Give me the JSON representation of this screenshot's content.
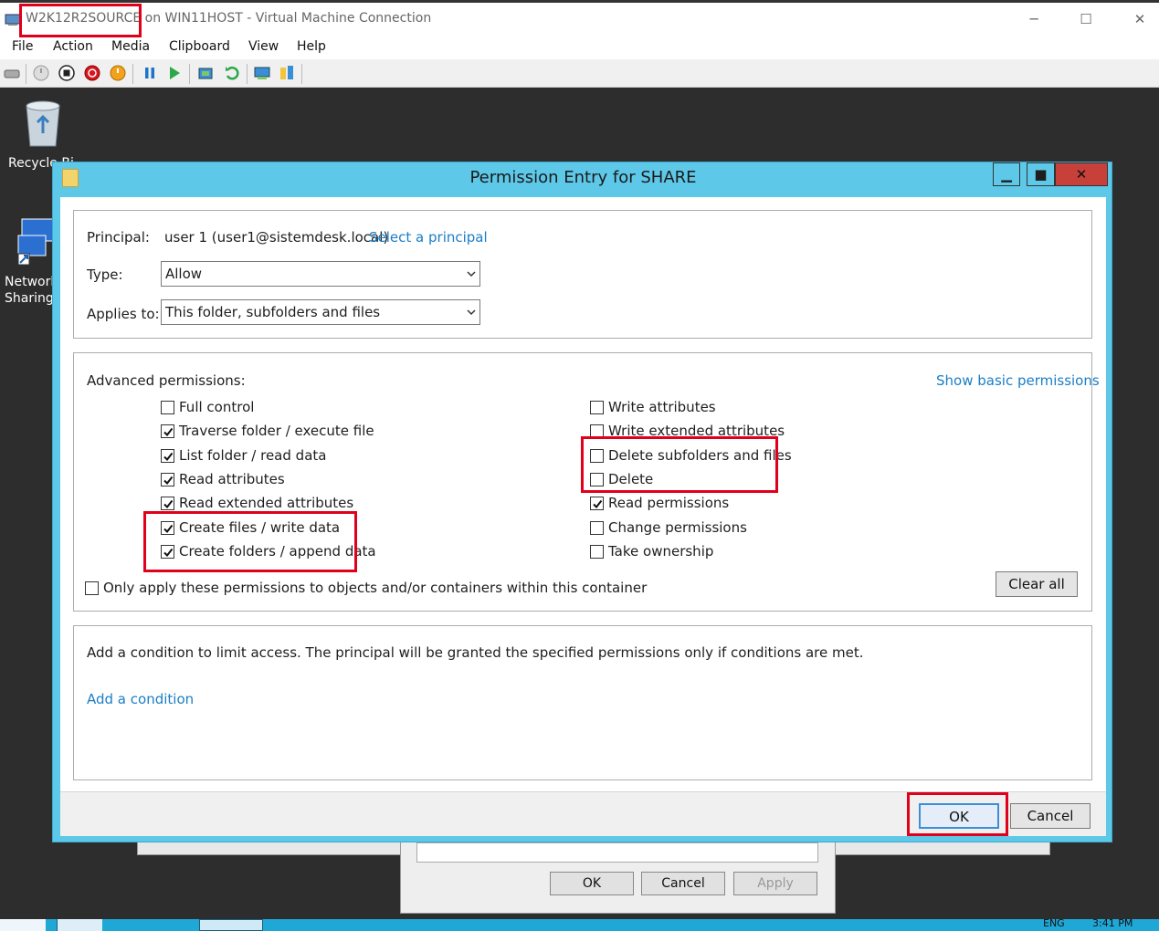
{
  "host": {
    "title": "W2K12R2SOURCE on WIN11HOST - Virtual Machine Connection",
    "minimize": "─",
    "maximize": "☐",
    "close": "✕",
    "menu": [
      "File",
      "Action",
      "Media",
      "Clipboard",
      "View",
      "Help"
    ]
  },
  "desktop": {
    "recycle_bin_label": "Recycle Bi",
    "network_label_1": "Network",
    "network_label_2": "Sharing"
  },
  "dialog": {
    "title": "Permission Entry for SHARE",
    "minimize": "▁",
    "maximize": "■",
    "close": "✕",
    "principal_label": "Principal:",
    "principal_value": "user 1 (user1@sistemdesk.local)",
    "select_principal": "Select a principal",
    "type_label": "Type:",
    "type_value": "Allow",
    "applies_label": "Applies to:",
    "applies_value": "This folder, subfolders and files",
    "advanced_label": "Advanced permissions:",
    "show_basic": "Show basic permissions",
    "perms_left": [
      {
        "label": "Full control",
        "checked": false
      },
      {
        "label": "Traverse folder / execute file",
        "checked": true
      },
      {
        "label": "List folder / read data",
        "checked": true
      },
      {
        "label": "Read attributes",
        "checked": true
      },
      {
        "label": "Read extended attributes",
        "checked": true
      },
      {
        "label": "Create files / write data",
        "checked": true
      },
      {
        "label": "Create folders / append data",
        "checked": true
      }
    ],
    "perms_right": [
      {
        "label": "Write attributes",
        "checked": false
      },
      {
        "label": "Write extended attributes",
        "checked": false
      },
      {
        "label": "Delete subfolders and files",
        "checked": false
      },
      {
        "label": "Delete",
        "checked": false
      },
      {
        "label": "Read permissions",
        "checked": true
      },
      {
        "label": "Change permissions",
        "checked": false
      },
      {
        "label": "Take ownership",
        "checked": false
      }
    ],
    "only_apply": "Only apply these permissions to objects and/or containers within this container",
    "clear_all": "Clear all",
    "condition_text": "Add a condition to limit access. The principal will be granted the specified permissions only if conditions are met.",
    "add_condition": "Add a condition",
    "ok": "OK",
    "cancel": "Cancel"
  },
  "background_dialog": {
    "ok": "OK",
    "cancel": "Cancel",
    "apply": "Apply"
  },
  "taskbar": {
    "lang": "ENG",
    "time": "3:41 PM"
  },
  "colors": {
    "dialog_frame": "#5ec8e8",
    "highlight": "#e0001b",
    "link": "#1a7ec6",
    "close_button": "#c8403a"
  }
}
